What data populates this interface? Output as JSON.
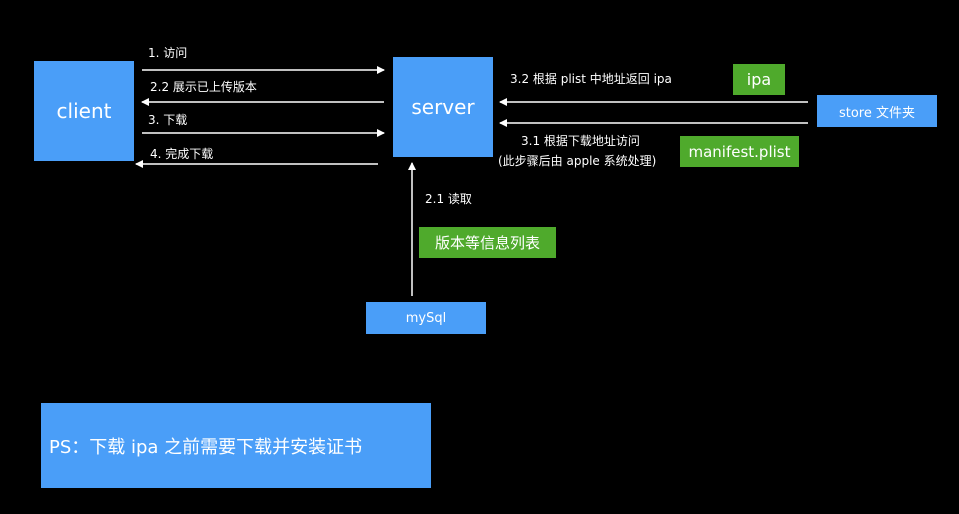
{
  "colors": {
    "background": "#000000",
    "node_fill": "#4a9ef8",
    "tag_fill": "#4faa2c",
    "text": "#ffffff",
    "arrow": "#ffffff"
  },
  "nodes": {
    "client": "client",
    "server": "server",
    "store": "store 文件夹",
    "mysql": "mySql"
  },
  "tags": {
    "ipa": "ipa",
    "manifest": "manifest.plist",
    "version_list": "版本等信息列表"
  },
  "edges": {
    "visit": "1. 访问",
    "show_version": "2.2 展示已上传版本",
    "download": "3. 下载",
    "download_done": "4. 完成下载",
    "return_ipa": "3.2 根据 plist 中地址返回 ipa",
    "manifest_visit": "3.1 根据下载地址访问",
    "manifest_note": "(此步骤后由 apple 系统处理)",
    "read": "2.1 读取"
  },
  "note": "PS：下载 ipa 之前需要下载并安装证书"
}
